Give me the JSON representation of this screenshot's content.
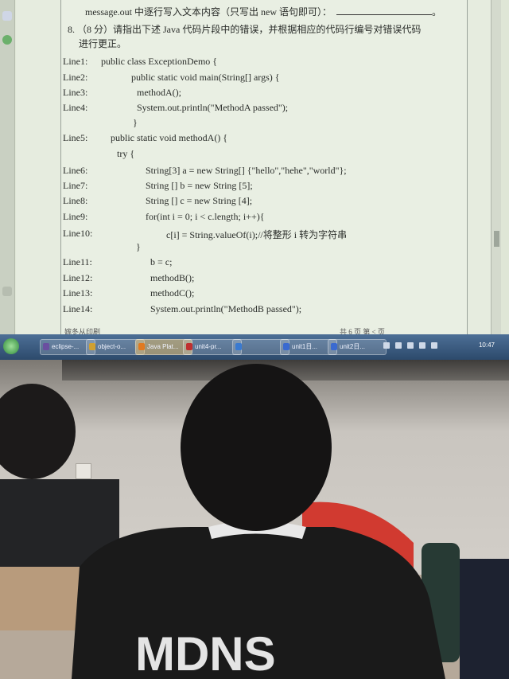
{
  "document": {
    "header_line": "message.out 中逐行写入文本内容（只写出 new 语句即可）：",
    "header_end": "。",
    "question_line1": "8. （8 分）请指出下述 Java 代码片段中的错误，并根据相应的代码行编号对错误代码",
    "question_line2": "进行更正。",
    "code": [
      {
        "label": "Line1:",
        "code": "public class ExceptionDemo {"
      },
      {
        "label": "Line2:",
        "code": "public static void    main(String[] args)    {"
      },
      {
        "label": "Line3:",
        "code": "methodA();"
      },
      {
        "label": "Line4:",
        "code": "System.out.println(\"MethodA passed\");"
      },
      {
        "label": "",
        "code": "}"
      },
      {
        "label": "Line5:",
        "code": "public static void    methodA()    {"
      },
      {
        "label": "",
        "code": "try {"
      },
      {
        "label": "Line6:",
        "code": "String[3] a = new String[] {\"hello\",\"hehe\",\"world\"};"
      },
      {
        "label": "Line7:",
        "code": "String [] b = new String [5];"
      },
      {
        "label": "Line8:",
        "code": "String [] c = new String [4];"
      },
      {
        "label": "Line9:",
        "code": "for(int i = 0; i < c.length; i++){"
      },
      {
        "label": "Line10:",
        "code": "c[i] = String.valueOf(i);//将整形 i 转为字符串"
      },
      {
        "label": "",
        "code": "}"
      },
      {
        "label": "Line11:",
        "code": "b = c;"
      },
      {
        "label": "Line12:",
        "code": "methodB();"
      },
      {
        "label": "Line13:",
        "code": "methodC();"
      },
      {
        "label": "Line14:",
        "code": "System.out.println(\"MethodB passed\");"
      }
    ],
    "footer_left": "嫁冬从印刷",
    "footer_right": "共 6 页    第 < 页"
  },
  "taskbar": {
    "items": [
      {
        "label": "eclipse-...",
        "color": "#6a4fa0"
      },
      {
        "label": "object-o...",
        "color": "#d0a030"
      },
      {
        "label": "Java Plat...",
        "color": "#e07a20",
        "active": true
      },
      {
        "label": "unit4-pr...",
        "color": "#c03030"
      },
      {
        "label": "",
        "color": "#3a7ad0"
      },
      {
        "label": "unit1日...",
        "color": "#3a6ad0"
      },
      {
        "label": "unit2日...",
        "color": "#3a6ad0"
      }
    ],
    "clock": "10:47"
  }
}
